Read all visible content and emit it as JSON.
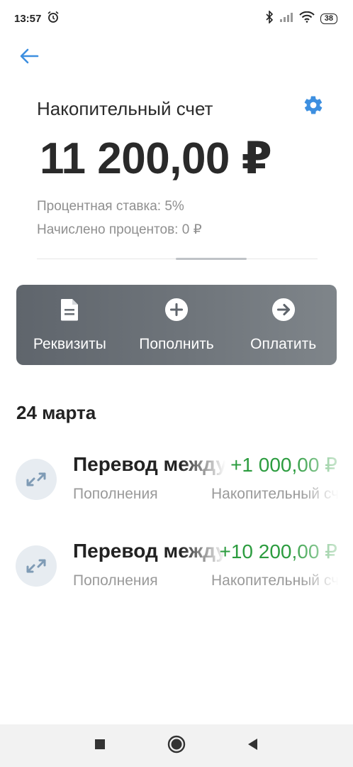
{
  "status_bar": {
    "time": "13:57",
    "alarm_icon": "alarm-clock-icon",
    "bluetooth_icon": "bluetooth-icon",
    "signal_icon": "cell-signal-icon",
    "wifi_icon": "wifi-icon",
    "battery": "38"
  },
  "header": {
    "back_icon": "arrow-left-icon",
    "title": "Накопительный счет",
    "settings_icon": "gear-icon"
  },
  "account": {
    "balance": "11 200,00 ₽",
    "interest_rate": "Процентная ставка: 5%",
    "accrued": "Начислено процентов: 0 ₽"
  },
  "actions": [
    {
      "label": "Реквизиты",
      "icon": "document-icon"
    },
    {
      "label": "Пополнить",
      "icon": "plus-circle-icon"
    },
    {
      "label": "Оплатить",
      "icon": "arrow-right-circle-icon"
    }
  ],
  "transactions": {
    "date": "24 марта",
    "items": [
      {
        "title": "Перевод между счетами",
        "amount": "+1 000,00 ₽",
        "category": "Пополнения",
        "account": "Накопительный счет",
        "icon": "transfer-arrows-icon"
      },
      {
        "title": "Перевод между счетами",
        "amount": "+10 200,00 ₽",
        "category": "Пополнения",
        "account": "Накопительный счет",
        "icon": "transfer-arrows-icon"
      }
    ]
  },
  "nav_bar": {
    "recent_icon": "square-icon",
    "home_icon": "circle-icon",
    "back_icon": "triangle-back-icon"
  },
  "colors": {
    "accent_blue": "#3d8fe0",
    "income_green": "#2c9c3f",
    "panel_gray": "#6a7076"
  }
}
